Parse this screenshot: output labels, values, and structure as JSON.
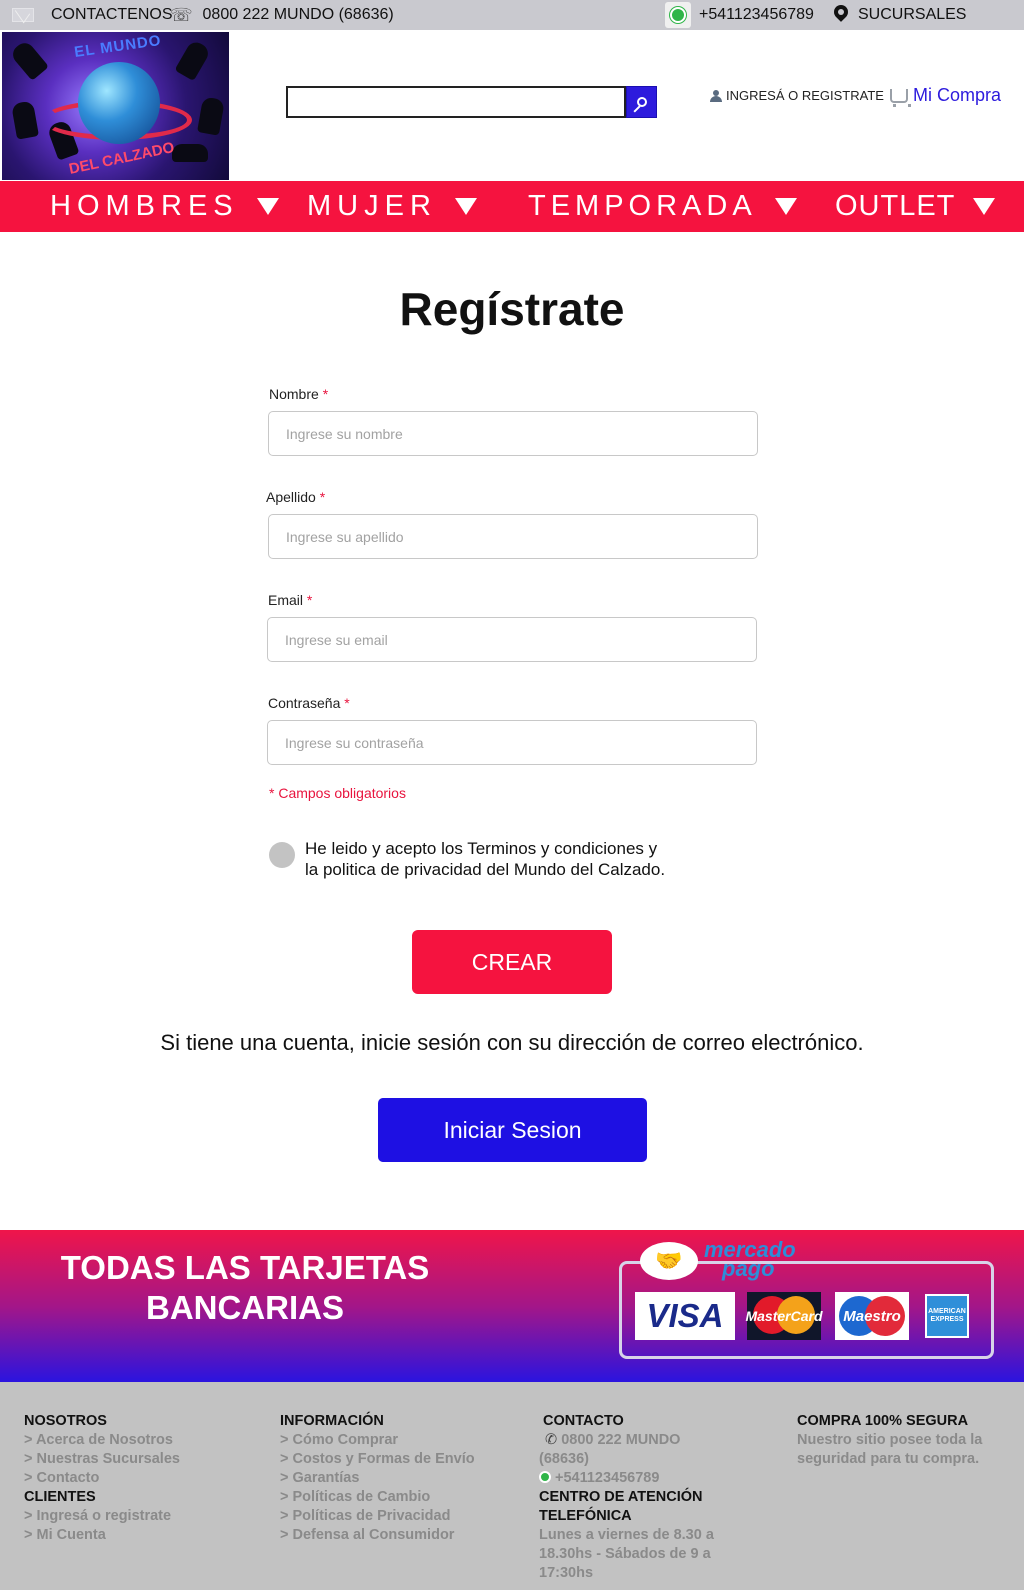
{
  "topbar": {
    "contact_label": "CONTACTENOS",
    "phone": "0800 222 MUNDO (68636)",
    "whatsapp": "+541123456789",
    "branches": "SUCURSALES"
  },
  "header": {
    "logo_text_top": "EL MUNDO",
    "logo_text_bottom": "DEL CALZADO",
    "login_label": "INGRESÁ O REGISTRATE",
    "cart_label": "Mi Compra",
    "search_value": ""
  },
  "nav": [
    {
      "label": "HOMBRES"
    },
    {
      "label": "MUJER"
    },
    {
      "label": "TEMPORADA"
    },
    {
      "label": "OUTLET"
    }
  ],
  "form": {
    "title": "Regístrate",
    "fields": [
      {
        "label": "Nombre",
        "placeholder": "Ingrese su nombre"
      },
      {
        "label": "Apellido",
        "placeholder": "Ingrese su apellido"
      },
      {
        "label": "Email",
        "placeholder": "Ingrese su email"
      },
      {
        "label": "Contraseña",
        "placeholder": "Ingrese su contraseña"
      }
    ],
    "required_mark": "*",
    "required_note": "* Campos obligatorios",
    "terms_line1": "He leido y acepto los Terminos y condiciones  y",
    "terms_line2": "la politica de privacidad del Mundo del Calzado.",
    "create_button": "CREAR",
    "signin_text": "Si tiene una cuenta, inicie sesión con su dirección de correo electrónico.",
    "login_button": "Iniciar Sesion"
  },
  "banner": {
    "title_line1": "TODAS LAS TARJETAS",
    "title_line2": "BANCARIAS",
    "mp_line1": "mercado",
    "mp_line2": "pago",
    "cards": [
      "VISA",
      "MasterCard",
      "Maestro",
      "AMERICAN EXPRESS"
    ]
  },
  "footer": {
    "nosotros": {
      "title": "NOSOTROS",
      "links": [
        "> Acerca de Nosotros",
        "> Nuestras Sucursales",
        "> Contacto"
      ]
    },
    "clientes": {
      "title": "CLIENTES",
      "links": [
        "> Ingresá o registrate",
        "> Mi Cuenta"
      ]
    },
    "informacion": {
      "title": "INFORMACIÓN",
      "links": [
        "> Cómo Comprar",
        "> Costos y Formas de Envío",
        "> Garantías",
        "> Políticas de Cambio",
        "> Políticas de Privacidad",
        "> Defensa al Consumidor"
      ]
    },
    "contacto": {
      "title": "CONTACTO",
      "phone_line1": "0800 222 MUNDO",
      "phone_line2": "(68636)",
      "whatsapp": "+541123456789",
      "center_title_1": "CENTRO DE ATENCIÓN",
      "center_title_2": "TELEFÓNICA",
      "hours_1": "Lunes a viernes de 8.30 a",
      "hours_2": "18.30hs - Sábados de 9 a",
      "hours_3": "17:30hs"
    },
    "segura": {
      "title": "COMPRA 100% SEGURA",
      "text_1": "Nuestro sitio posee toda la",
      "text_2": "seguridad para tu compra."
    }
  },
  "colors": {
    "accent_red": "#f5133f",
    "accent_blue": "#1e10e3",
    "topbar_gray": "#c9c9cf",
    "footer_gray": "#c2c2c2"
  }
}
